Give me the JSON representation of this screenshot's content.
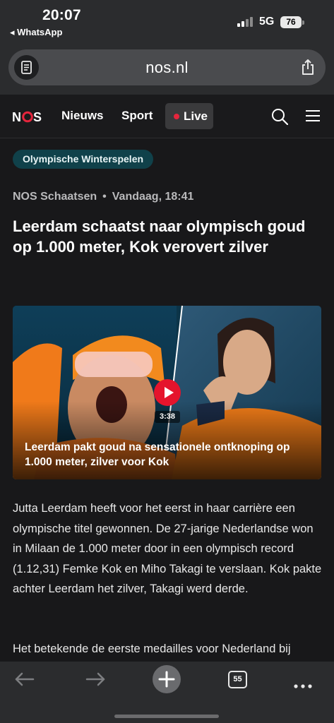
{
  "status_bar": {
    "time": "20:07",
    "back_app": "◂ WhatsApp",
    "network": "5G",
    "battery": "76"
  },
  "browser": {
    "url": "nos.nl",
    "tab_count": "55"
  },
  "site_header": {
    "logo": "NOS",
    "nav": [
      "Nieuws",
      "Sport"
    ],
    "live_label": "Live",
    "accent_color": "#e5253c"
  },
  "article": {
    "tag": "Olympische Winterspelen",
    "source": "NOS Schaatsen",
    "separator": "•",
    "time": "Vandaag, 18:41",
    "headline": "Leerdam schaatst naar olympisch goud op 1.000 meter, Kok verovert zilver",
    "video": {
      "duration": "3:38",
      "caption": "Leerdam pakt goud na sensationele ontknoping op 1.000 meter, zilver voor Kok"
    },
    "paragraphs": [
      "Jutta Leerdam heeft voor het eerst in haar carrière een olympische titel gewonnen. De 27-jarige Nederlandse won in Milaan de 1.000 meter door in een olympisch record (1.12,31) Femke Kok en Miho Takagi te verslaan. Kok pakte achter Leerdam het zilver, Takagi werd derde.",
      "Het betekende de eerste medailles voor Nederland bij"
    ]
  },
  "icons": {
    "reader": "reader-mode-icon",
    "share": "share-icon",
    "search": "search-icon",
    "menu": "hamburger-menu-icon",
    "back": "back-arrow-icon",
    "forward": "forward-arrow-icon",
    "new_tab": "plus-icon",
    "more": "more-icon",
    "play": "play-icon"
  }
}
